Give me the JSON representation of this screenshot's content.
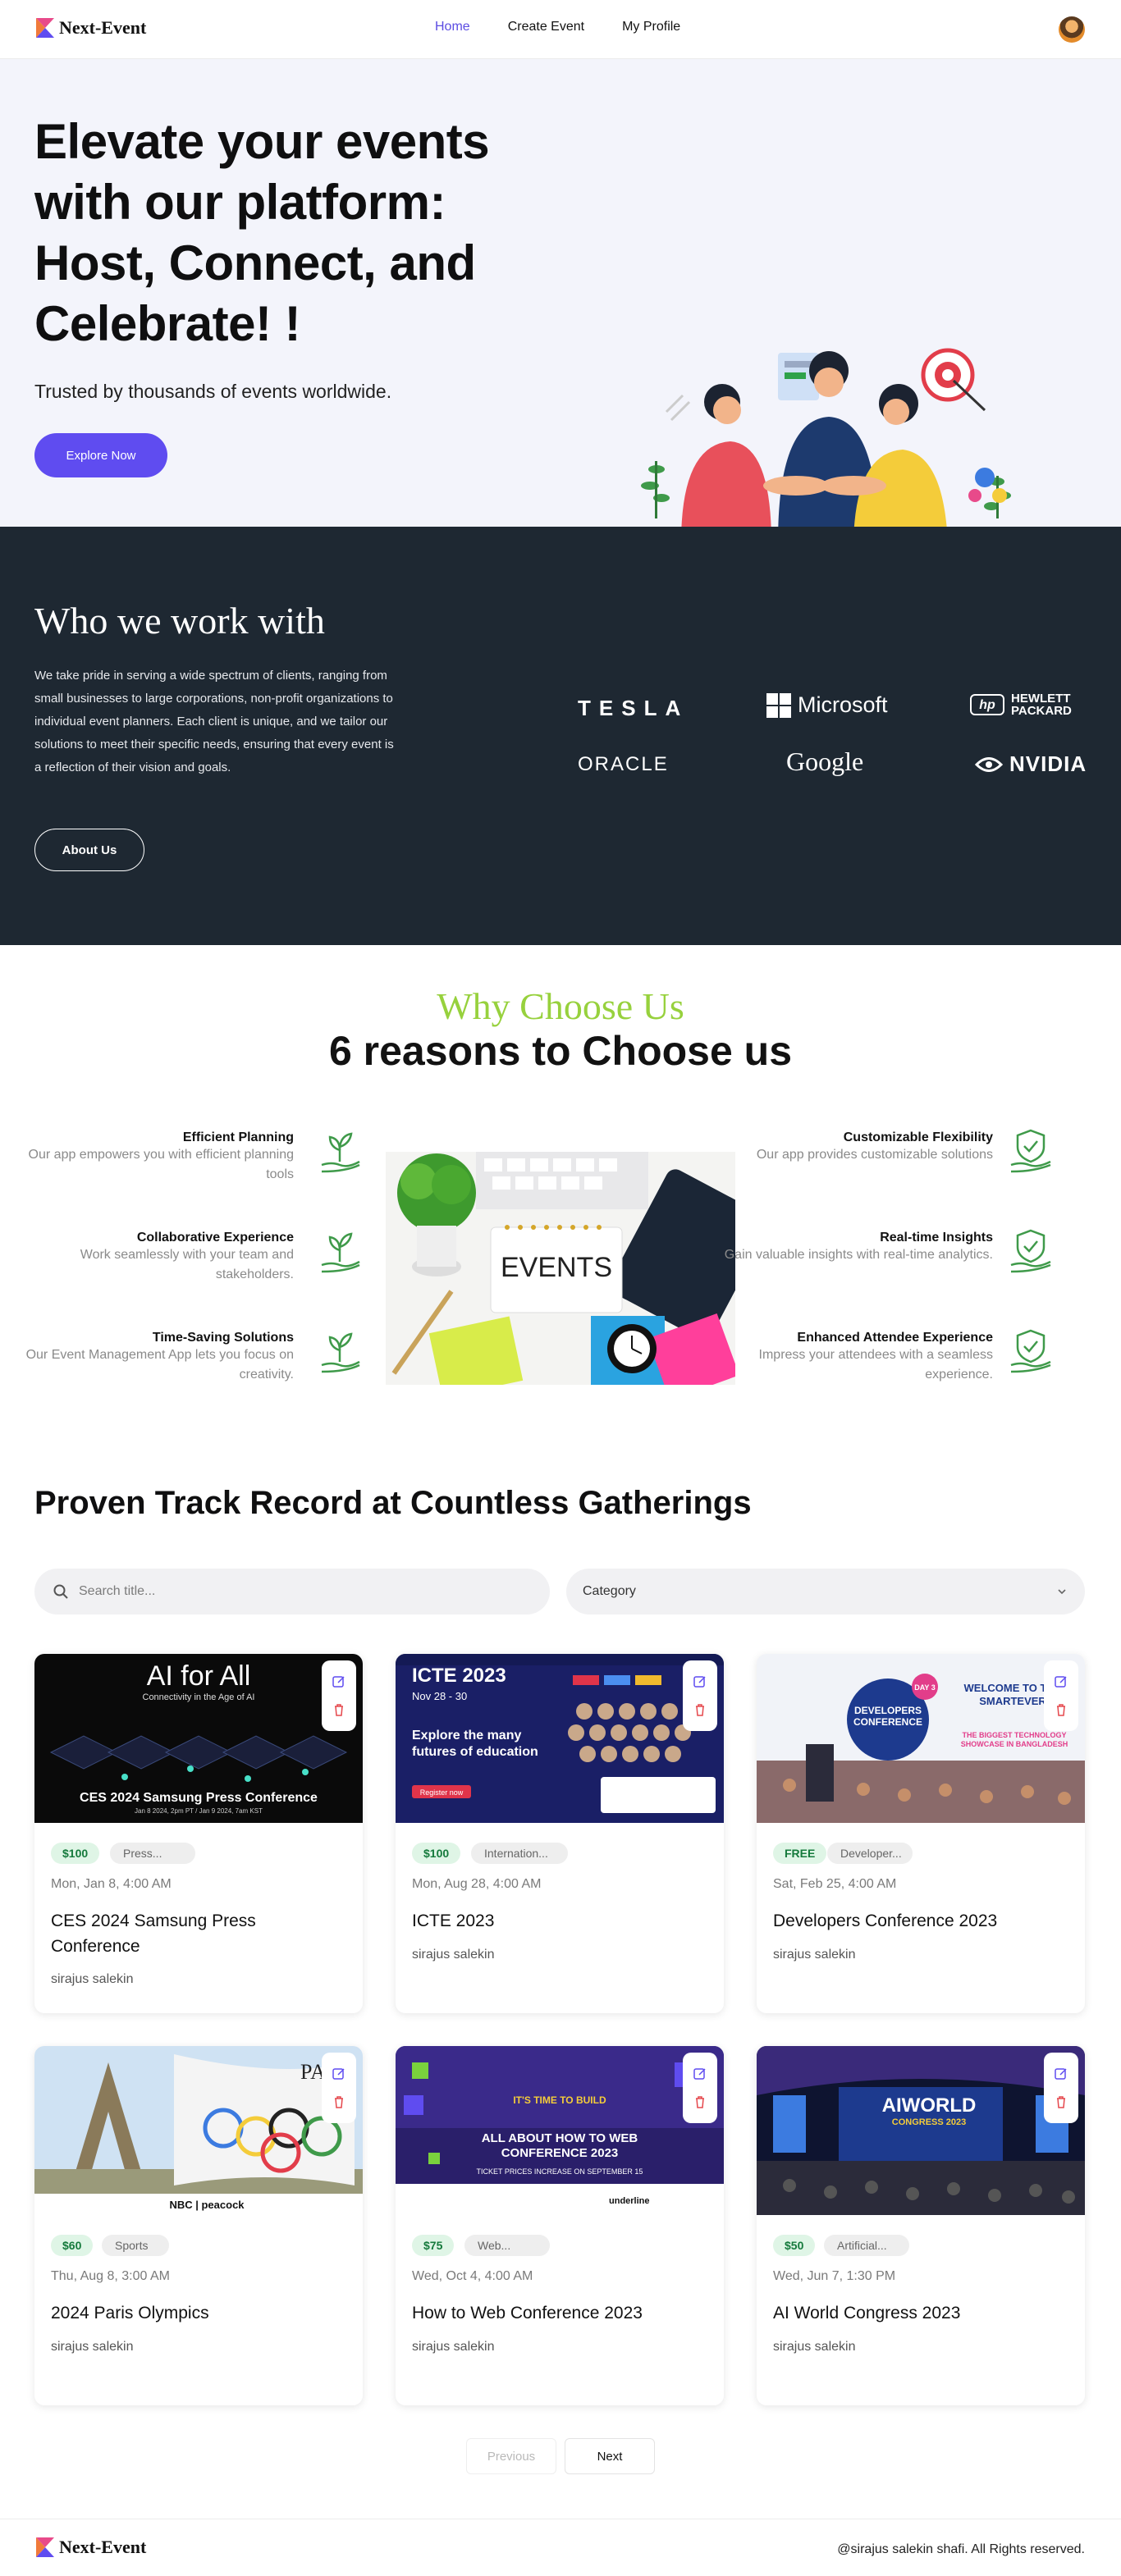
{
  "nav": {
    "brand": "Next-Event",
    "links": [
      "Home",
      "Create Event",
      "My Profile"
    ]
  },
  "hero": {
    "title": "Elevate your events with our platform: Host, Connect, and Celebrate! !",
    "subtitle": "Trusted by thousands of events worldwide.",
    "cta": "Explore Now"
  },
  "clients": {
    "title": "Who we work with",
    "description": "We take pride in serving a wide spectrum of clients, ranging from small businesses to large corporations, non-profit organizations to individual event planners. Each client is unique, and we tailor our solutions to meet their specific needs, ensuring that every event is a reflection of their vision and goals.",
    "button": "About Us",
    "logos": {
      "tesla": "TESLA",
      "microsoft": "Microsoft",
      "hp_line1": "HEWLETT",
      "hp_line2": "PACKARD",
      "hp_badge": "hp",
      "oracle": "ORACLE",
      "google": "Google",
      "nvidia": "NVIDIA"
    }
  },
  "why": {
    "kicker": "Why Choose Us",
    "title": "6 reasons to Choose us",
    "image_text": "EVENTS",
    "features": [
      {
        "title": "Efficient Planning",
        "desc": "Our app empowers you with efficient planning tools"
      },
      {
        "title": "Collaborative Experience",
        "desc": "Work seamlessly with your team and stakeholders."
      },
      {
        "title": "Time-Saving Solutions",
        "desc": "Our Event Management App lets you focus on creativity."
      },
      {
        "title": "Customizable Flexibility",
        "desc": "Our app provides customizable solutions"
      },
      {
        "title": "Real-time Insights",
        "desc": "Gain valuable insights with real-time analytics."
      },
      {
        "title": "Enhanced Attendee Experience",
        "desc": "Impress your attendees with a seamless experience."
      }
    ]
  },
  "track": {
    "title": "Proven Track Record at Countless Gatherings",
    "search_placeholder": "Search title...",
    "category_label": "Category"
  },
  "events": [
    {
      "price": "$100",
      "category": "Press...",
      "date": "Mon, Jan 8, 4:00 AM",
      "title": "CES 2024 Samsung Press Conference",
      "organizer": "sirajus salekin",
      "image_title": "AI for All",
      "image_sub": "Connectivity in the Age of AI",
      "image_caption": "CES 2024 Samsung Press Conference",
      "image_caption2": "Jan 8 2024, 2pm PT / Jan 9 2024, 7am KST"
    },
    {
      "price": "$100",
      "category": "Internation...",
      "date": "Mon, Aug 28, 4:00 AM",
      "title": "ICTE 2023",
      "organizer": "sirajus salekin",
      "image_title": "ICTE 2023",
      "image_sub": "Nov 28 - 30",
      "image_caption": "Explore the many futures of education",
      "image_caption2": "Register now"
    },
    {
      "price": "FREE",
      "category": "Developer...",
      "date": "Sat, Feb 25, 4:00 AM",
      "title": "Developers Conference 2023",
      "organizer": "sirajus salekin",
      "image_title": "DEVELOPERS CONFERENCE",
      "image_sub": "WELCOME TO THE SMARTEVER",
      "image_caption": "THE BIGGEST TECHNOLOGY SHOWCASE IN BANGLADESH",
      "image_caption2": "DAY 3"
    },
    {
      "price": "$60",
      "category": "Sports",
      "date": "Thu, Aug 8, 3:00 AM",
      "title": "2024 Paris Olympics",
      "organizer": "sirajus salekin",
      "image_title": "PA",
      "image_sub": "NBC | peacock",
      "image_caption": "",
      "image_caption2": ""
    },
    {
      "price": "$75",
      "category": "Web...",
      "date": "Wed, Oct 4, 4:00 AM",
      "title": "How to Web Conference 2023",
      "organizer": "sirajus salekin",
      "image_title": "ALL ABOUT HOW TO WEB CONFERENCE 2023",
      "image_sub": "IT'S TIME TO BUILD",
      "image_caption": "TICKET PRICES INCREASE ON SEPTEMBER 15",
      "image_caption2": "underline"
    },
    {
      "price": "$50",
      "category": "Artificial...",
      "date": "Wed, Jun 7, 1:30 PM",
      "title": "AI World Congress 2023",
      "organizer": "sirajus salekin",
      "image_title": "AIWORLD",
      "image_sub": "CONGRESS 2023",
      "image_caption": "",
      "image_caption2": ""
    }
  ],
  "pagination": {
    "previous": "Previous",
    "next": "Next"
  },
  "footer": {
    "brand": "Next-Event",
    "copyright": "@sirajus salekin shafi. All Rights reserved."
  },
  "colors": {
    "accent": "#5f4cf0",
    "dark": "#1e2832",
    "green": "#97d13d",
    "price_bg": "#dff5e6",
    "price_text": "#157a3c"
  }
}
